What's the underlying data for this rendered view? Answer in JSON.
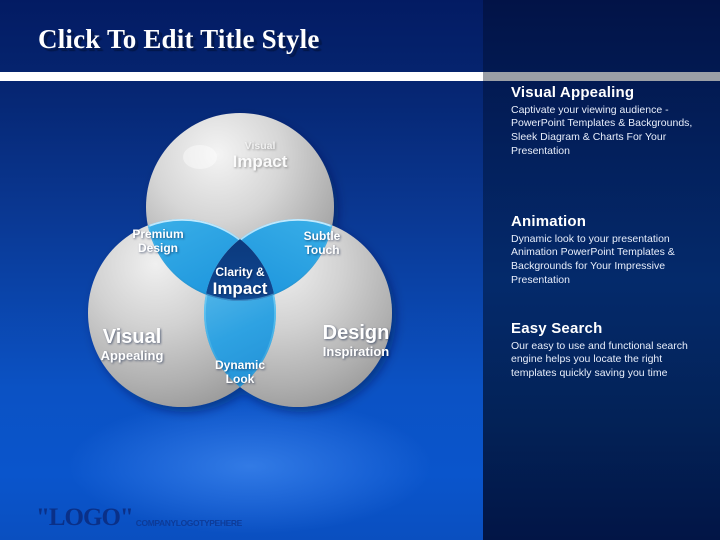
{
  "slide": {
    "title": "Click To Edit Title Style",
    "accent_blue": "#0b52c4",
    "panel_navy": "#042a6b",
    "divider_white": "#ffffff",
    "divider_gray": "#9b9fa6",
    "circle_gray": "#b9b9b9",
    "lens_blue": "#1f9fe0",
    "core_navy": "#04285e"
  },
  "venn": {
    "top": {
      "small": "Visual",
      "big": "Impact"
    },
    "left": {
      "big": "Visual",
      "sub": "Appealing"
    },
    "right": {
      "big": "Design",
      "sub": "Inspiration"
    },
    "top_left_overlap": {
      "line1": "Premium",
      "line2": "Design"
    },
    "top_right_overlap": {
      "line1": "Subtle",
      "line2": "Touch"
    },
    "bottom_overlap": {
      "line1": "Dynamic",
      "line2": "Look"
    },
    "center": {
      "small": "Clarity &",
      "big": "Impact"
    }
  },
  "panel": {
    "blocks": [
      {
        "heading": "Visual Appealing",
        "body": "Captivate your viewing audience - PowerPoint Templates & Backgrounds, Sleek Diagram & Charts For Your Presentation"
      },
      {
        "heading": "Animation",
        "body": "Dynamic look to your presentation Animation PowerPoint Templates & Backgrounds for Your Impressive Presentation"
      },
      {
        "heading": "Easy Search",
        "body": "Our easy to use and functional search engine helps you locate the right templates quickly saving you time"
      }
    ]
  },
  "logo": {
    "mark": "\"LOGO\"",
    "subtitle": "COMPANYLOGOTYPEHERE"
  }
}
